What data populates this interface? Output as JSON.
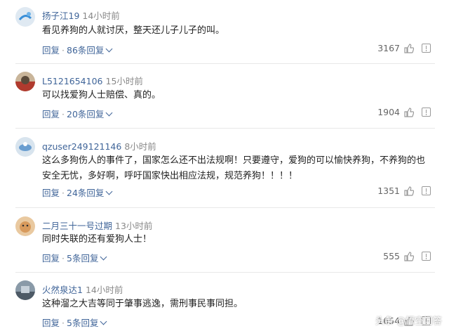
{
  "comments": [
    {
      "user": "扬子江19",
      "time": "14小时前",
      "text": "看见养狗的人就讨厌，整天还儿子儿子的叫。",
      "reply_label": "回复",
      "sep": "·",
      "replies": "86条回复",
      "likes": "3167"
    },
    {
      "user": "L5121654106",
      "time": "15小时前",
      "text": "可以找爱狗人士赔偿、真的。",
      "reply_label": "回复",
      "sep": "·",
      "replies": "20条回复",
      "likes": "1904"
    },
    {
      "user": "qzuser249121146",
      "time": "8小时前",
      "text": "这么多狗伤人的事件了，国家怎么还不出法规啊！只要遵守，爱狗的可以愉快养狗，不养狗的也安全无忧，多好啊，呼吁国家快出相应法规，规范养狗！！！！",
      "reply_label": "回复",
      "sep": "·",
      "replies": "24条回复",
      "likes": "1351"
    },
    {
      "user": "二月三十一号过期",
      "time": "13小时前",
      "text": "同时失联的还有爱狗人士！",
      "reply_label": "回复",
      "sep": "·",
      "replies": "5条回复",
      "likes": "555"
    },
    {
      "user": "火然泉达1",
      "time": "14小时前",
      "text": "这种溜之大吉等同于肇事逃逸，需刑事民事同担。",
      "reply_label": "回复",
      "sep": "·",
      "replies": "5条回复",
      "likes": "1654"
    }
  ],
  "watermark": "头条 @悟空问答",
  "icons": {
    "like": "thumbs-up-icon",
    "report": "report-icon"
  }
}
